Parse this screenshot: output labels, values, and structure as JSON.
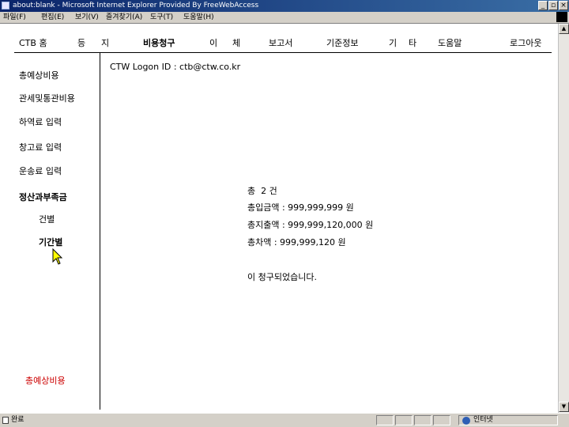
{
  "window": {
    "title": "about:blank - Microsoft Internet Explorer Provided By FreeWebAccess",
    "controls": [
      "_",
      "▫",
      "×"
    ]
  },
  "menubar": [
    "파일(F)",
    "편집(E)",
    "보기(V)",
    "즐겨찾기(A)",
    "도구(T)",
    "도움말(H)"
  ],
  "topnav": [
    {
      "label": "CTB 홈"
    },
    {
      "label": "등"
    },
    {
      "label": "지"
    },
    {
      "label": "비용청구",
      "active": true
    },
    {
      "label": "이"
    },
    {
      "label": "체"
    },
    {
      "label": "보고서"
    },
    {
      "label": "기준정보"
    },
    {
      "label": "기"
    },
    {
      "label": "타"
    },
    {
      "label": "도움말"
    },
    {
      "label": "로그아웃"
    }
  ],
  "sidebar": {
    "items": [
      {
        "label": "총예상비용"
      },
      {
        "label": "관세및통관비용"
      },
      {
        "label": "하역료 입력"
      },
      {
        "label": "창고료 입력"
      },
      {
        "label": "운송료 입력"
      },
      {
        "label": "정산과부족금"
      },
      {
        "label": "건별"
      },
      {
        "label": "기간별"
      }
    ],
    "footer_link": "총예상비용"
  },
  "content": {
    "logon": "CTW Logon ID : ctb@ctw.co.kr",
    "total_count": "총  2 건",
    "deposit": "총입금액 : 999,999,999 원",
    "payment": "총지출액 : 999,999,120,000 원",
    "difference": "총차액 : 999,999,120 원",
    "message": "이 청구되었습니다."
  },
  "statusbar": {
    "left": "완료",
    "zone": "인터넷"
  },
  "colors": {
    "titlebar": "#0a246a",
    "footer_link": "#cc0000"
  }
}
